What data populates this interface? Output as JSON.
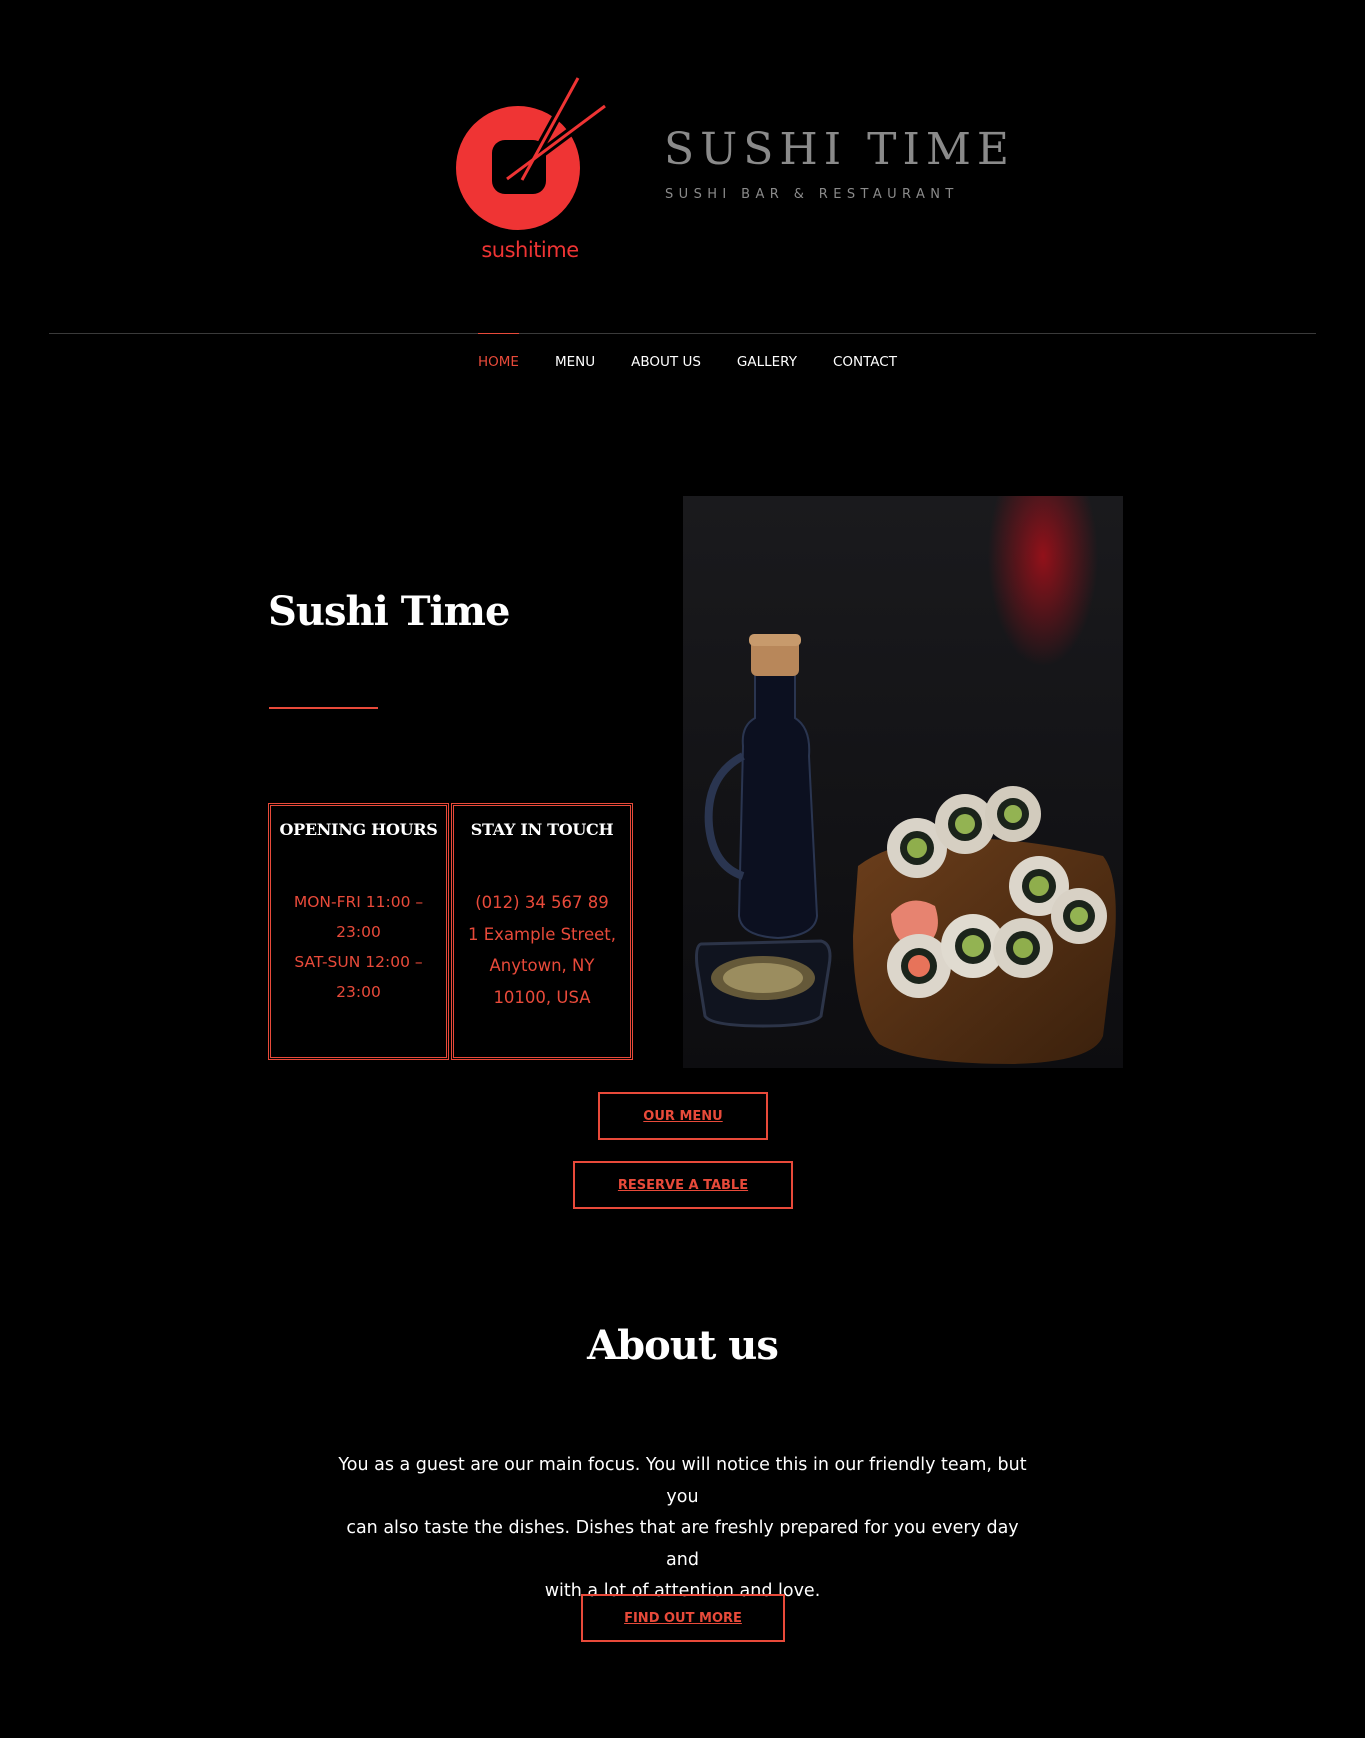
{
  "brand": {
    "logo_text": "sushitime",
    "title": "SUSHI TIME",
    "tagline": "SUSHI BAR & RESTAURANT",
    "accent_color": "#ef3434"
  },
  "nav": {
    "items": [
      {
        "label": "HOME",
        "active": true
      },
      {
        "label": "MENU",
        "active": false
      },
      {
        "label": "ABOUT US",
        "active": false
      },
      {
        "label": "GALLERY",
        "active": false
      },
      {
        "label": "CONTACT",
        "active": false
      }
    ]
  },
  "hero": {
    "title": "Sushi Time",
    "hours": {
      "heading": "OPENING HOURS",
      "lines": [
        "MON-FRI 11:00 –",
        "23:00",
        "SAT-SUN 12:00 –",
        "23:00"
      ]
    },
    "touch": {
      "heading": "STAY IN TOUCH",
      "lines": [
        "(012) 34 567 89",
        "1 Example Street,",
        "Anytown, NY",
        "10100, USA"
      ]
    },
    "photo_icon": "sushi-photo"
  },
  "buttons": {
    "menu": "OUR MENU",
    "reserve": "RESERVE A TABLE",
    "more": "FIND OUT MORE"
  },
  "about": {
    "title": "About us",
    "text_lines": [
      "You as a guest are our main focus. You will notice this in our friendly team, but you",
      "can also taste the dishes. Dishes that are freshly prepared for you every day and",
      "with a lot of attention and love."
    ]
  },
  "colors": {
    "background": "#000000",
    "accent": "#e84a3a",
    "muted_title": "#8a8a8a"
  }
}
